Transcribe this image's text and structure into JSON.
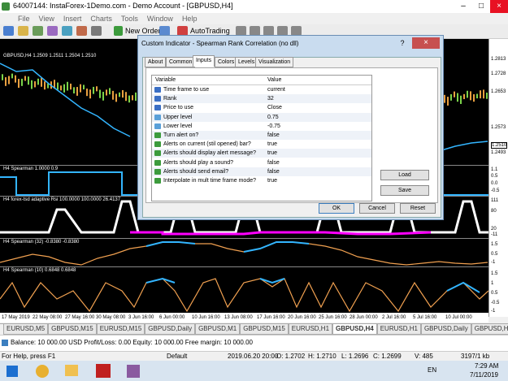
{
  "window": {
    "title": "64007144: InstaForex-1Demo.com - Demo Account - [GBPUSD,H4]",
    "minimize": "–",
    "maximize": "□",
    "close": "×"
  },
  "menu": [
    "File",
    "View",
    "Insert",
    "Charts",
    "Tools",
    "Window",
    "Help"
  ],
  "toolbar": {
    "new_order": "New Order",
    "autotrading": "AutoTrading"
  },
  "chart": {
    "main_label": "GBPUSD,H4  1.2509 1.2511 1.2504 1.2510",
    "panel1_label": "H4 Spearman  1.0000  0.9",
    "panel2_label": "H4 forex-tsd adaptive Rsi  100.0000  100.0000 26.4137",
    "panel3_label": "H4 Spearman (32) -0.8380 -0.8380",
    "panel4_label": "H4 Spearman (10) 0.6848 0.6848",
    "price_scale": [
      "1.2813",
      "1.2728",
      "1.2653",
      "1.2573",
      "1.2510",
      "1.2493"
    ],
    "panel1_scale": [
      "1.1",
      "0.5",
      "0.0",
      "-0.5"
    ],
    "panel2_scale": [
      "111",
      "80",
      "20",
      "-11"
    ],
    "panel3_scale": [
      "1.5",
      "0.5",
      "-1"
    ],
    "panel4_scale": [
      "1.5",
      "1",
      "0.5",
      "-0.5",
      "-1"
    ],
    "dates": [
      "17 May 2019",
      "22 May 08:00",
      "27 May 16:00",
      "30 May 08:00",
      "3 Jun 16:00",
      "6 Jun 00:00",
      "10 Jun 16:00",
      "13 Jun 08:00",
      "17 Jun 16:00",
      "20 Jun 16:00",
      "25 Jun 16:00",
      "28 Jun 00:00",
      "2 Jul 16:00",
      "5 Jul 16:00",
      "10 Jul 00:00"
    ]
  },
  "tabs": [
    "EURUSD,M5",
    "GBPUSD,M15",
    "EURUSD,M15",
    "GBPUSD,Daily",
    "GBPUSD,M1",
    "GBPUSD,M15",
    "EURUSD,H1",
    "GBPUSD,H4",
    "EURUSD,H1",
    "GBPUSD,Daily",
    "GBPUSD,H1"
  ],
  "active_tab_index": 7,
  "balance": "Balance: 10 000.00 USD  Profit/Loss: 0.00  Equity: 10 000.00  Free margin: 10 000.00",
  "status": {
    "help": "For Help, press F1",
    "profile": "Default",
    "time": "2019.06.20 20:00",
    "open": "O: 1.2702",
    "high": "H: 1.2710",
    "low": "L: 1.2696",
    "close": "C: 1.2699",
    "volume": "V: 485",
    "traffic": "3197/1 kb"
  },
  "taskbar": {
    "lang": "EN",
    "clock": "7:29 AM",
    "date": "7/11/2019"
  },
  "dialog": {
    "title": "Custom Indicator - Spearman Rank Correlation (no dll)",
    "help": "?",
    "close": "×",
    "tabs": [
      "About",
      "Common",
      "Inputs",
      "Colors",
      "Levels",
      "Visualization"
    ],
    "active_tab": 2,
    "col_variable": "Variable",
    "col_value": "Value",
    "rows": [
      {
        "name": "Time frame to use",
        "value": "current",
        "icon": "enum"
      },
      {
        "name": "Rank",
        "value": "32",
        "icon": "int"
      },
      {
        "name": "Price to use",
        "value": "Close",
        "icon": "enum"
      },
      {
        "name": "Upper level",
        "value": "0.75",
        "icon": "double"
      },
      {
        "name": "Lower level",
        "value": "-0.75",
        "icon": "double"
      },
      {
        "name": "Turn alert on?",
        "value": "false",
        "icon": "bool"
      },
      {
        "name": "Alerts on current (stil opened) bar?",
        "value": "true",
        "icon": "bool"
      },
      {
        "name": "Alerts should display alert message?",
        "value": "true",
        "icon": "bool"
      },
      {
        "name": "Alerts should play a sound?",
        "value": "false",
        "icon": "bool"
      },
      {
        "name": "Alerts should send email?",
        "value": "false",
        "icon": "bool"
      },
      {
        "name": "Interpolate in mult time frame mode?",
        "value": "true",
        "icon": "bool"
      }
    ],
    "load": "Load",
    "save": "Save",
    "ok": "OK",
    "cancel": "Cancel",
    "reset": "Reset"
  },
  "colors": {
    "icon_enum": "#3b6fc4",
    "icon_int": "#3b6fc4",
    "icon_double": "#5aa0d8",
    "icon_bool": "#3c9b3c",
    "row_alt": "#eef2f8"
  }
}
